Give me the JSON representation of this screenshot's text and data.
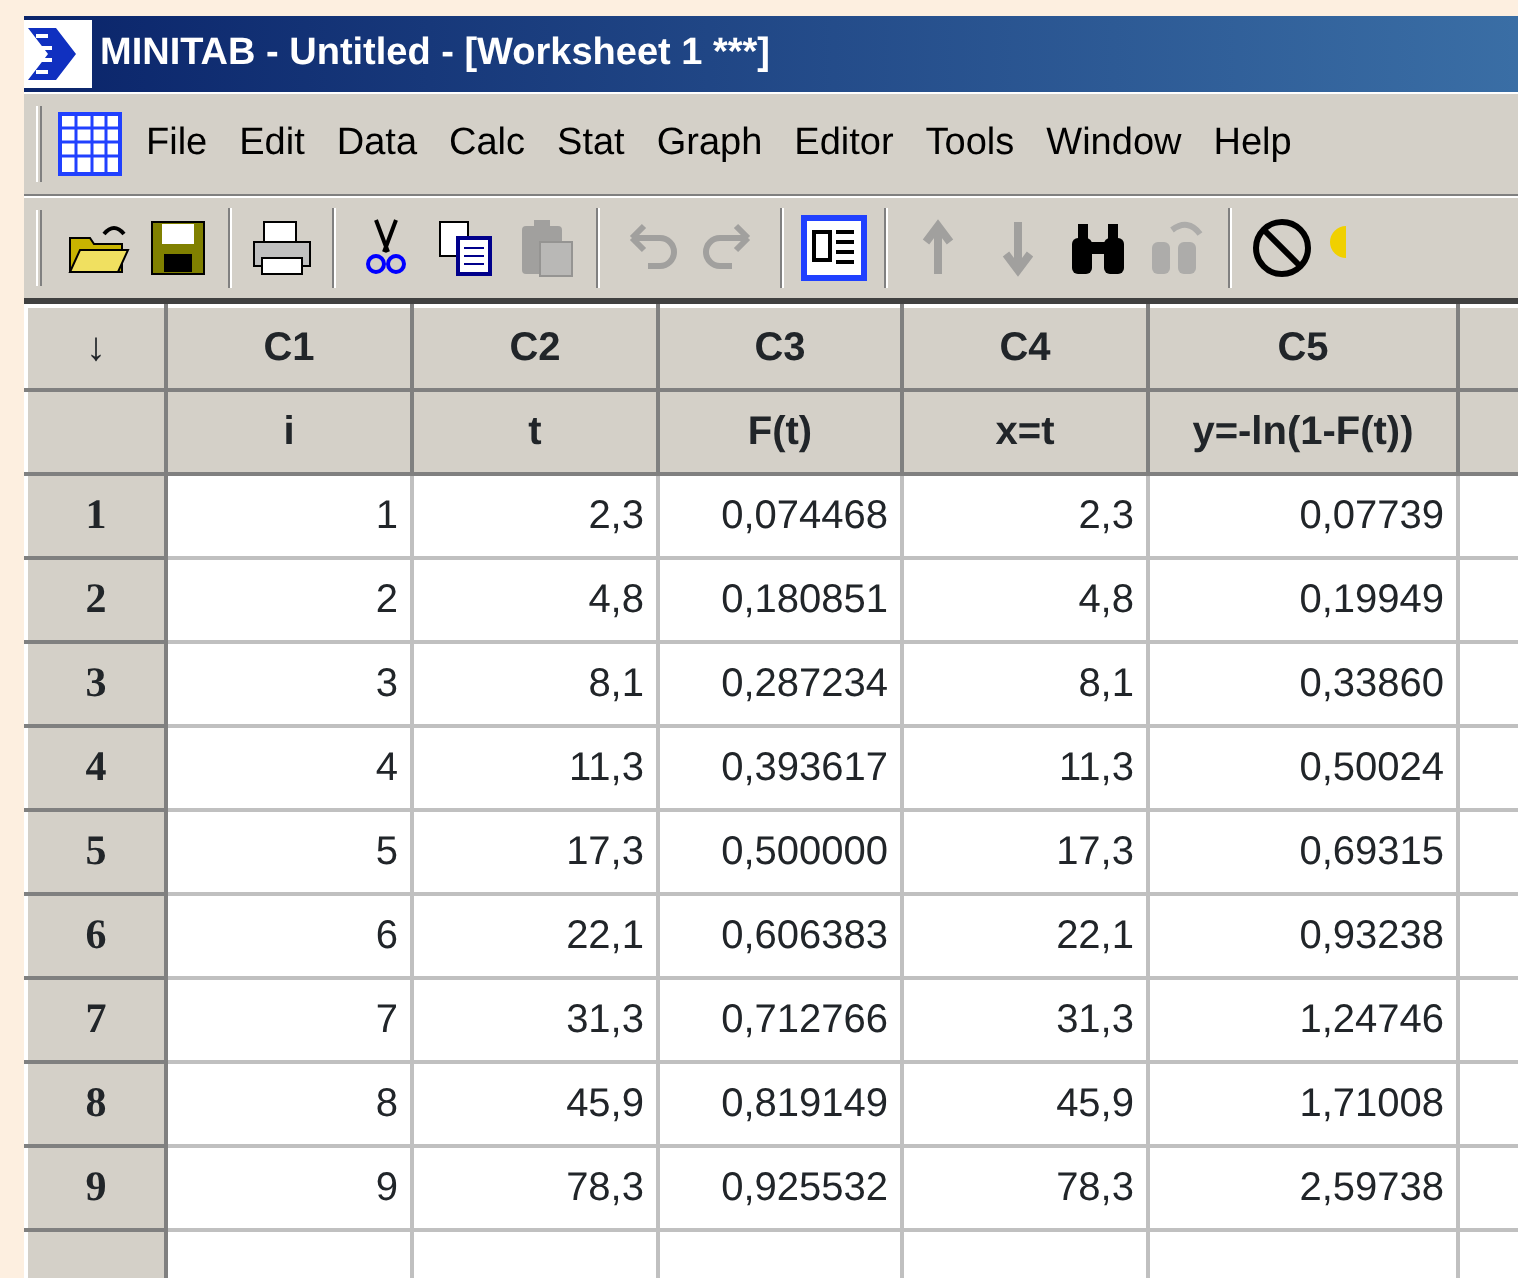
{
  "window": {
    "title": "MINITAB - Untitled - [Worksheet 1 ***]"
  },
  "menu": [
    {
      "label": "File"
    },
    {
      "label": "Edit"
    },
    {
      "label": "Data"
    },
    {
      "label": "Calc"
    },
    {
      "label": "Stat"
    },
    {
      "label": "Graph"
    },
    {
      "label": "Editor"
    },
    {
      "label": "Tools"
    },
    {
      "label": "Window"
    },
    {
      "label": "Help"
    }
  ],
  "toolbar": [
    {
      "kind": "open",
      "disabled": false
    },
    {
      "kind": "save",
      "disabled": false
    },
    {
      "kind": "sep"
    },
    {
      "kind": "print",
      "disabled": false
    },
    {
      "kind": "sep"
    },
    {
      "kind": "cut",
      "disabled": false
    },
    {
      "kind": "copy",
      "disabled": false
    },
    {
      "kind": "paste",
      "disabled": true
    },
    {
      "kind": "sep"
    },
    {
      "kind": "undo",
      "disabled": true
    },
    {
      "kind": "redo",
      "disabled": true
    },
    {
      "kind": "sep"
    },
    {
      "kind": "session",
      "disabled": false
    },
    {
      "kind": "sep"
    },
    {
      "kind": "up",
      "disabled": true
    },
    {
      "kind": "down",
      "disabled": true
    },
    {
      "kind": "find",
      "disabled": false
    },
    {
      "kind": "replace",
      "disabled": true
    },
    {
      "kind": "sep"
    },
    {
      "kind": "cancel",
      "disabled": false
    }
  ],
  "worksheet": {
    "corner": "↓",
    "columns": [
      {
        "id": "C1",
        "name": "i"
      },
      {
        "id": "C2",
        "name": "t"
      },
      {
        "id": "C3",
        "name": "F(t)"
      },
      {
        "id": "C4",
        "name": "x=t"
      },
      {
        "id": "C5",
        "name": "y=-ln(1-F(t))"
      }
    ],
    "rows": [
      {
        "number": "1",
        "cells": [
          "1",
          "2,3",
          "0,074468",
          "2,3",
          "0,07739"
        ]
      },
      {
        "number": "2",
        "cells": [
          "2",
          "4,8",
          "0,180851",
          "4,8",
          "0,19949"
        ]
      },
      {
        "number": "3",
        "cells": [
          "3",
          "8,1",
          "0,287234",
          "8,1",
          "0,33860"
        ]
      },
      {
        "number": "4",
        "cells": [
          "4",
          "11,3",
          "0,393617",
          "11,3",
          "0,50024"
        ]
      },
      {
        "number": "5",
        "cells": [
          "5",
          "17,3",
          "0,500000",
          "17,3",
          "0,69315"
        ]
      },
      {
        "number": "6",
        "cells": [
          "6",
          "22,1",
          "0,606383",
          "22,1",
          "0,93238"
        ]
      },
      {
        "number": "7",
        "cells": [
          "7",
          "31,3",
          "0,712766",
          "31,3",
          "1,24746"
        ]
      },
      {
        "number": "8",
        "cells": [
          "8",
          "45,9",
          "0,819149",
          "45,9",
          "1,71008"
        ]
      },
      {
        "number": "9",
        "cells": [
          "9",
          "78,3",
          "0,925532",
          "78,3",
          "2,59738"
        ]
      }
    ]
  }
}
